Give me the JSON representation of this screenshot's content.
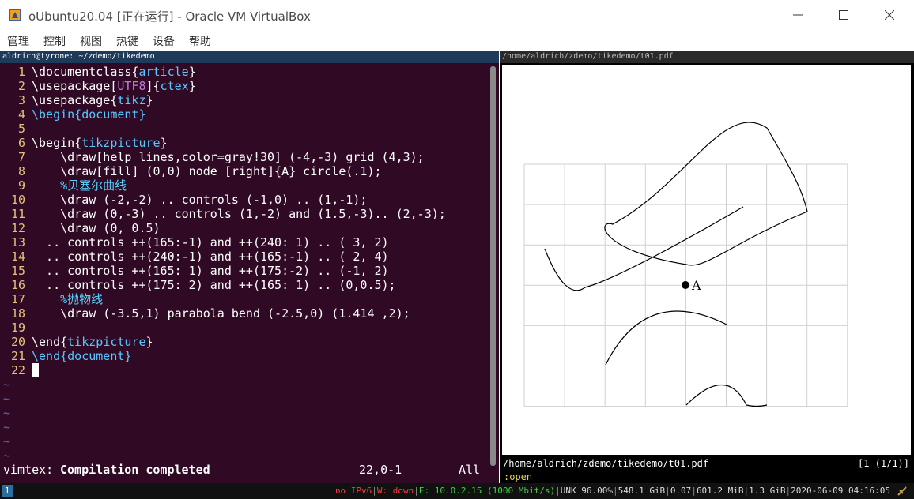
{
  "window": {
    "title": "oUbuntu20.04 [正在运行] - Oracle VM VirtualBox",
    "menu": [
      "管理",
      "控制",
      "视图",
      "热键",
      "设备",
      "帮助"
    ]
  },
  "terminal": {
    "title": "aldrich@tyrone: ~/zdemo/tikedemo",
    "lines": [
      {
        "n": "1",
        "parts": [
          [
            "cmd",
            "\\documentclass"
          ],
          [
            "plain",
            "{"
          ],
          [
            "kw",
            "article"
          ],
          [
            "plain",
            "}"
          ]
        ]
      },
      {
        "n": "2",
        "parts": [
          [
            "cmd",
            "\\usepackage"
          ],
          [
            "plain",
            "["
          ],
          [
            "opt",
            "UTF8"
          ],
          [
            "plain",
            "]{"
          ],
          [
            "kw",
            "ctex"
          ],
          [
            "plain",
            "}"
          ]
        ]
      },
      {
        "n": "3",
        "parts": [
          [
            "cmd",
            "\\usepackage"
          ],
          [
            "plain",
            "{"
          ],
          [
            "kw",
            "tikz"
          ],
          [
            "plain",
            "}"
          ]
        ]
      },
      {
        "n": "4",
        "parts": [
          [
            "kw",
            "\\begin{document}"
          ]
        ]
      },
      {
        "n": "5",
        "parts": []
      },
      {
        "n": "6",
        "parts": [
          [
            "cmd",
            "\\begin"
          ],
          [
            "plain",
            "{"
          ],
          [
            "kw",
            "tikzpicture"
          ],
          [
            "plain",
            "}"
          ]
        ]
      },
      {
        "n": "7",
        "parts": [
          [
            "plain",
            "    "
          ],
          [
            "cmd",
            "\\draw"
          ],
          [
            "plain",
            "[help lines,color=gray!30] (-4,-3) grid (4,3);"
          ]
        ]
      },
      {
        "n": "8",
        "parts": [
          [
            "plain",
            "    "
          ],
          [
            "cmd",
            "\\draw"
          ],
          [
            "plain",
            "[fill] (0,0) node [right]{A} circle(.1);"
          ]
        ]
      },
      {
        "n": "9",
        "parts": [
          [
            "plain",
            "    "
          ],
          [
            "cmt",
            "%贝塞尔曲线"
          ]
        ]
      },
      {
        "n": "10",
        "parts": [
          [
            "plain",
            "    "
          ],
          [
            "cmd",
            "\\draw"
          ],
          [
            "plain",
            " (-2,-2) .. controls (-1,0) .. (1,-1);"
          ]
        ]
      },
      {
        "n": "11",
        "parts": [
          [
            "plain",
            "    "
          ],
          [
            "cmd",
            "\\draw"
          ],
          [
            "plain",
            " (0,-3) .. controls (1,-2) and (1.5,-3).. (2,-3);"
          ]
        ]
      },
      {
        "n": "12",
        "parts": [
          [
            "plain",
            "    "
          ],
          [
            "cmd",
            "\\draw"
          ],
          [
            "plain",
            " (0, 0.5)"
          ]
        ]
      },
      {
        "n": "13",
        "parts": [
          [
            "plain",
            "  .. controls ++(165:-1) and ++(240: 1) .. ( 3, 2)"
          ]
        ]
      },
      {
        "n": "14",
        "parts": [
          [
            "plain",
            "  .. controls ++(240:-1) and ++(165:-1) .. ( 2, 4)"
          ]
        ]
      },
      {
        "n": "15",
        "parts": [
          [
            "plain",
            "  .. controls ++(165: 1) and ++(175:-2) .. (-1, 2)"
          ]
        ]
      },
      {
        "n": "16",
        "parts": [
          [
            "plain",
            "  .. controls ++(175: 2) and ++(165: 1) .. (0,0.5);"
          ]
        ]
      },
      {
        "n": "17",
        "parts": [
          [
            "plain",
            "    "
          ],
          [
            "cmt",
            "%抛物线"
          ]
        ]
      },
      {
        "n": "18",
        "parts": [
          [
            "plain",
            "    "
          ],
          [
            "cmd",
            "\\draw"
          ],
          [
            "plain",
            " (-3.5,1) parabola bend (-2.5,0) (1.414 ,2);"
          ]
        ]
      },
      {
        "n": "19",
        "parts": []
      },
      {
        "n": "20",
        "parts": [
          [
            "cmd",
            "\\end"
          ],
          [
            "plain",
            "{"
          ],
          [
            "kw",
            "tikzpicture"
          ],
          [
            "plain",
            "}"
          ]
        ]
      },
      {
        "n": "21",
        "parts": [
          [
            "kw",
            "\\end{document}"
          ]
        ]
      },
      {
        "n": "22",
        "parts": [],
        "cursor": true
      }
    ],
    "tildes": [
      "~",
      "~",
      "~",
      "~",
      "~",
      "~"
    ],
    "status": {
      "prefix": "vimtex:",
      "message": "Compilation completed",
      "position": "22,0-1",
      "scroll": "All"
    }
  },
  "pdf": {
    "title": "/home/aldrich/zdemo/tikedemo/t01.pdf",
    "node_label": "A",
    "status_path": "/home/aldrich/zdemo/tikedemo/t01.pdf",
    "status_page": "[1 (1/1)]",
    "command": ":open"
  },
  "taskbar": {
    "workspace": "1",
    "ipv6": "no IPv6",
    "wifi": "W: down",
    "eth": "E: 10.0.2.15 (1000 Mbit/s)",
    "battery": "UNK 96.00%",
    "disk": "548.1 GiB",
    "load": "0.07",
    "mem": "601.2 MiB",
    "swap": "1.3 GiB",
    "datetime": "2020-06-09 04:16:05"
  }
}
